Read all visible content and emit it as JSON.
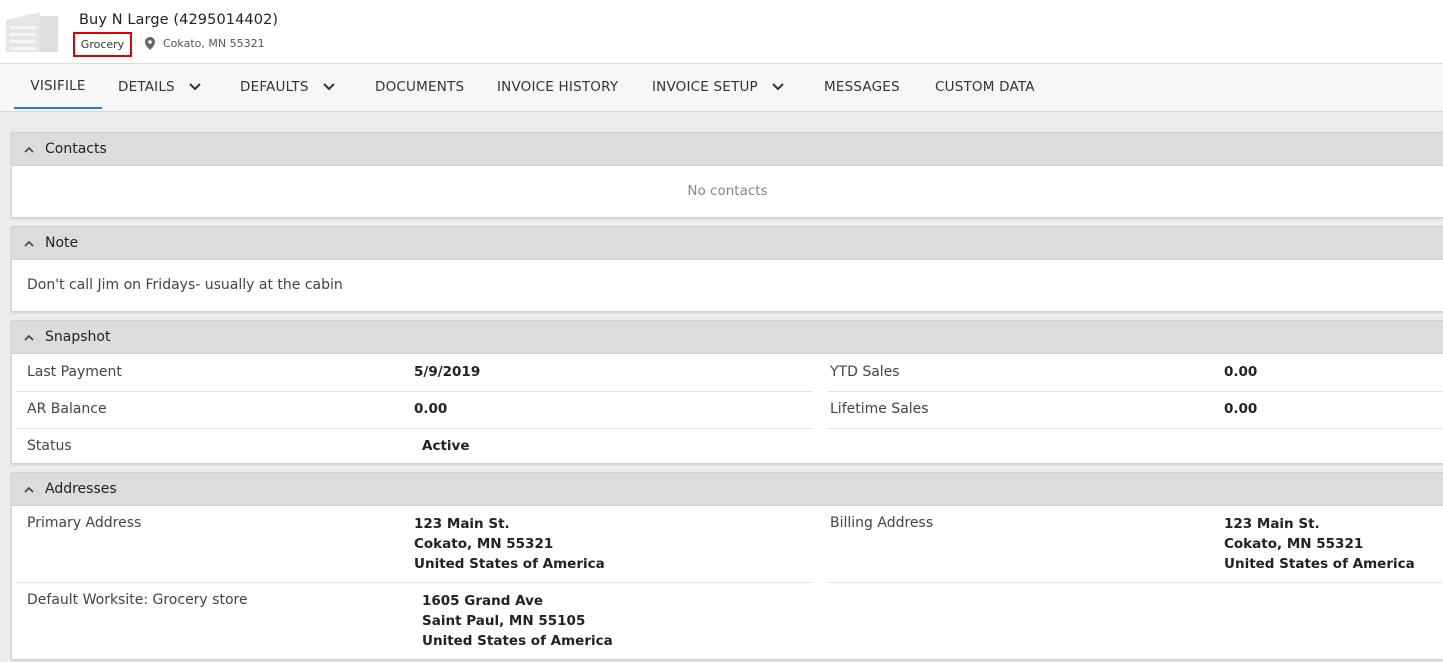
{
  "header": {
    "customer_name": "Buy N Large (4295014402)",
    "category": "Grocery",
    "location": "Cokato, MN 55321",
    "icons": {
      "avatar": "building-icon",
      "location": "map-pin-icon"
    }
  },
  "tabs": [
    {
      "label": "VISIFILE",
      "active": true,
      "dropdown": false
    },
    {
      "label": "DETAILS",
      "active": false,
      "dropdown": true
    },
    {
      "label": "DEFAULTS",
      "active": false,
      "dropdown": true
    },
    {
      "label": "DOCUMENTS",
      "active": false,
      "dropdown": false
    },
    {
      "label": "INVOICE HISTORY",
      "active": false,
      "dropdown": false
    },
    {
      "label": "INVOICE SETUP",
      "active": false,
      "dropdown": true
    },
    {
      "label": "MESSAGES",
      "active": false,
      "dropdown": false
    },
    {
      "label": "CUSTOM DATA",
      "active": false,
      "dropdown": false
    }
  ],
  "contacts": {
    "title": "Contacts",
    "empty_text": "No contacts"
  },
  "note": {
    "title": "Note",
    "text": "Don't call Jim on Fridays- usually at the cabin"
  },
  "snapshot": {
    "title": "Snapshot",
    "last_payment_label": "Last Payment",
    "last_payment_value": "5/9/2019",
    "ytd_sales_label": "YTD Sales",
    "ytd_sales_value": "0.00",
    "ar_balance_label": "AR Balance",
    "ar_balance_value": "0.00",
    "lifetime_sales_label": "Lifetime Sales",
    "lifetime_sales_value": "0.00",
    "status_label": "Status",
    "status_value": "Active"
  },
  "addresses": {
    "title": "Addresses",
    "primary_label": "Primary Address",
    "primary": [
      "123 Main St.",
      "Cokato, MN 55321",
      "United States of America"
    ],
    "billing_label": "Billing Address",
    "billing": [
      "123 Main St.",
      "Cokato, MN 55321",
      "United States of America"
    ],
    "worksite_label": "Default Worksite: Grocery store",
    "worksite": [
      "1605 Grand Ave",
      "Saint Paul, MN 55105",
      "United States of America"
    ]
  },
  "colors": {
    "accent": "#2a7fc6",
    "badge_border": "#e00000",
    "panel_header": "#dcdcdc"
  }
}
